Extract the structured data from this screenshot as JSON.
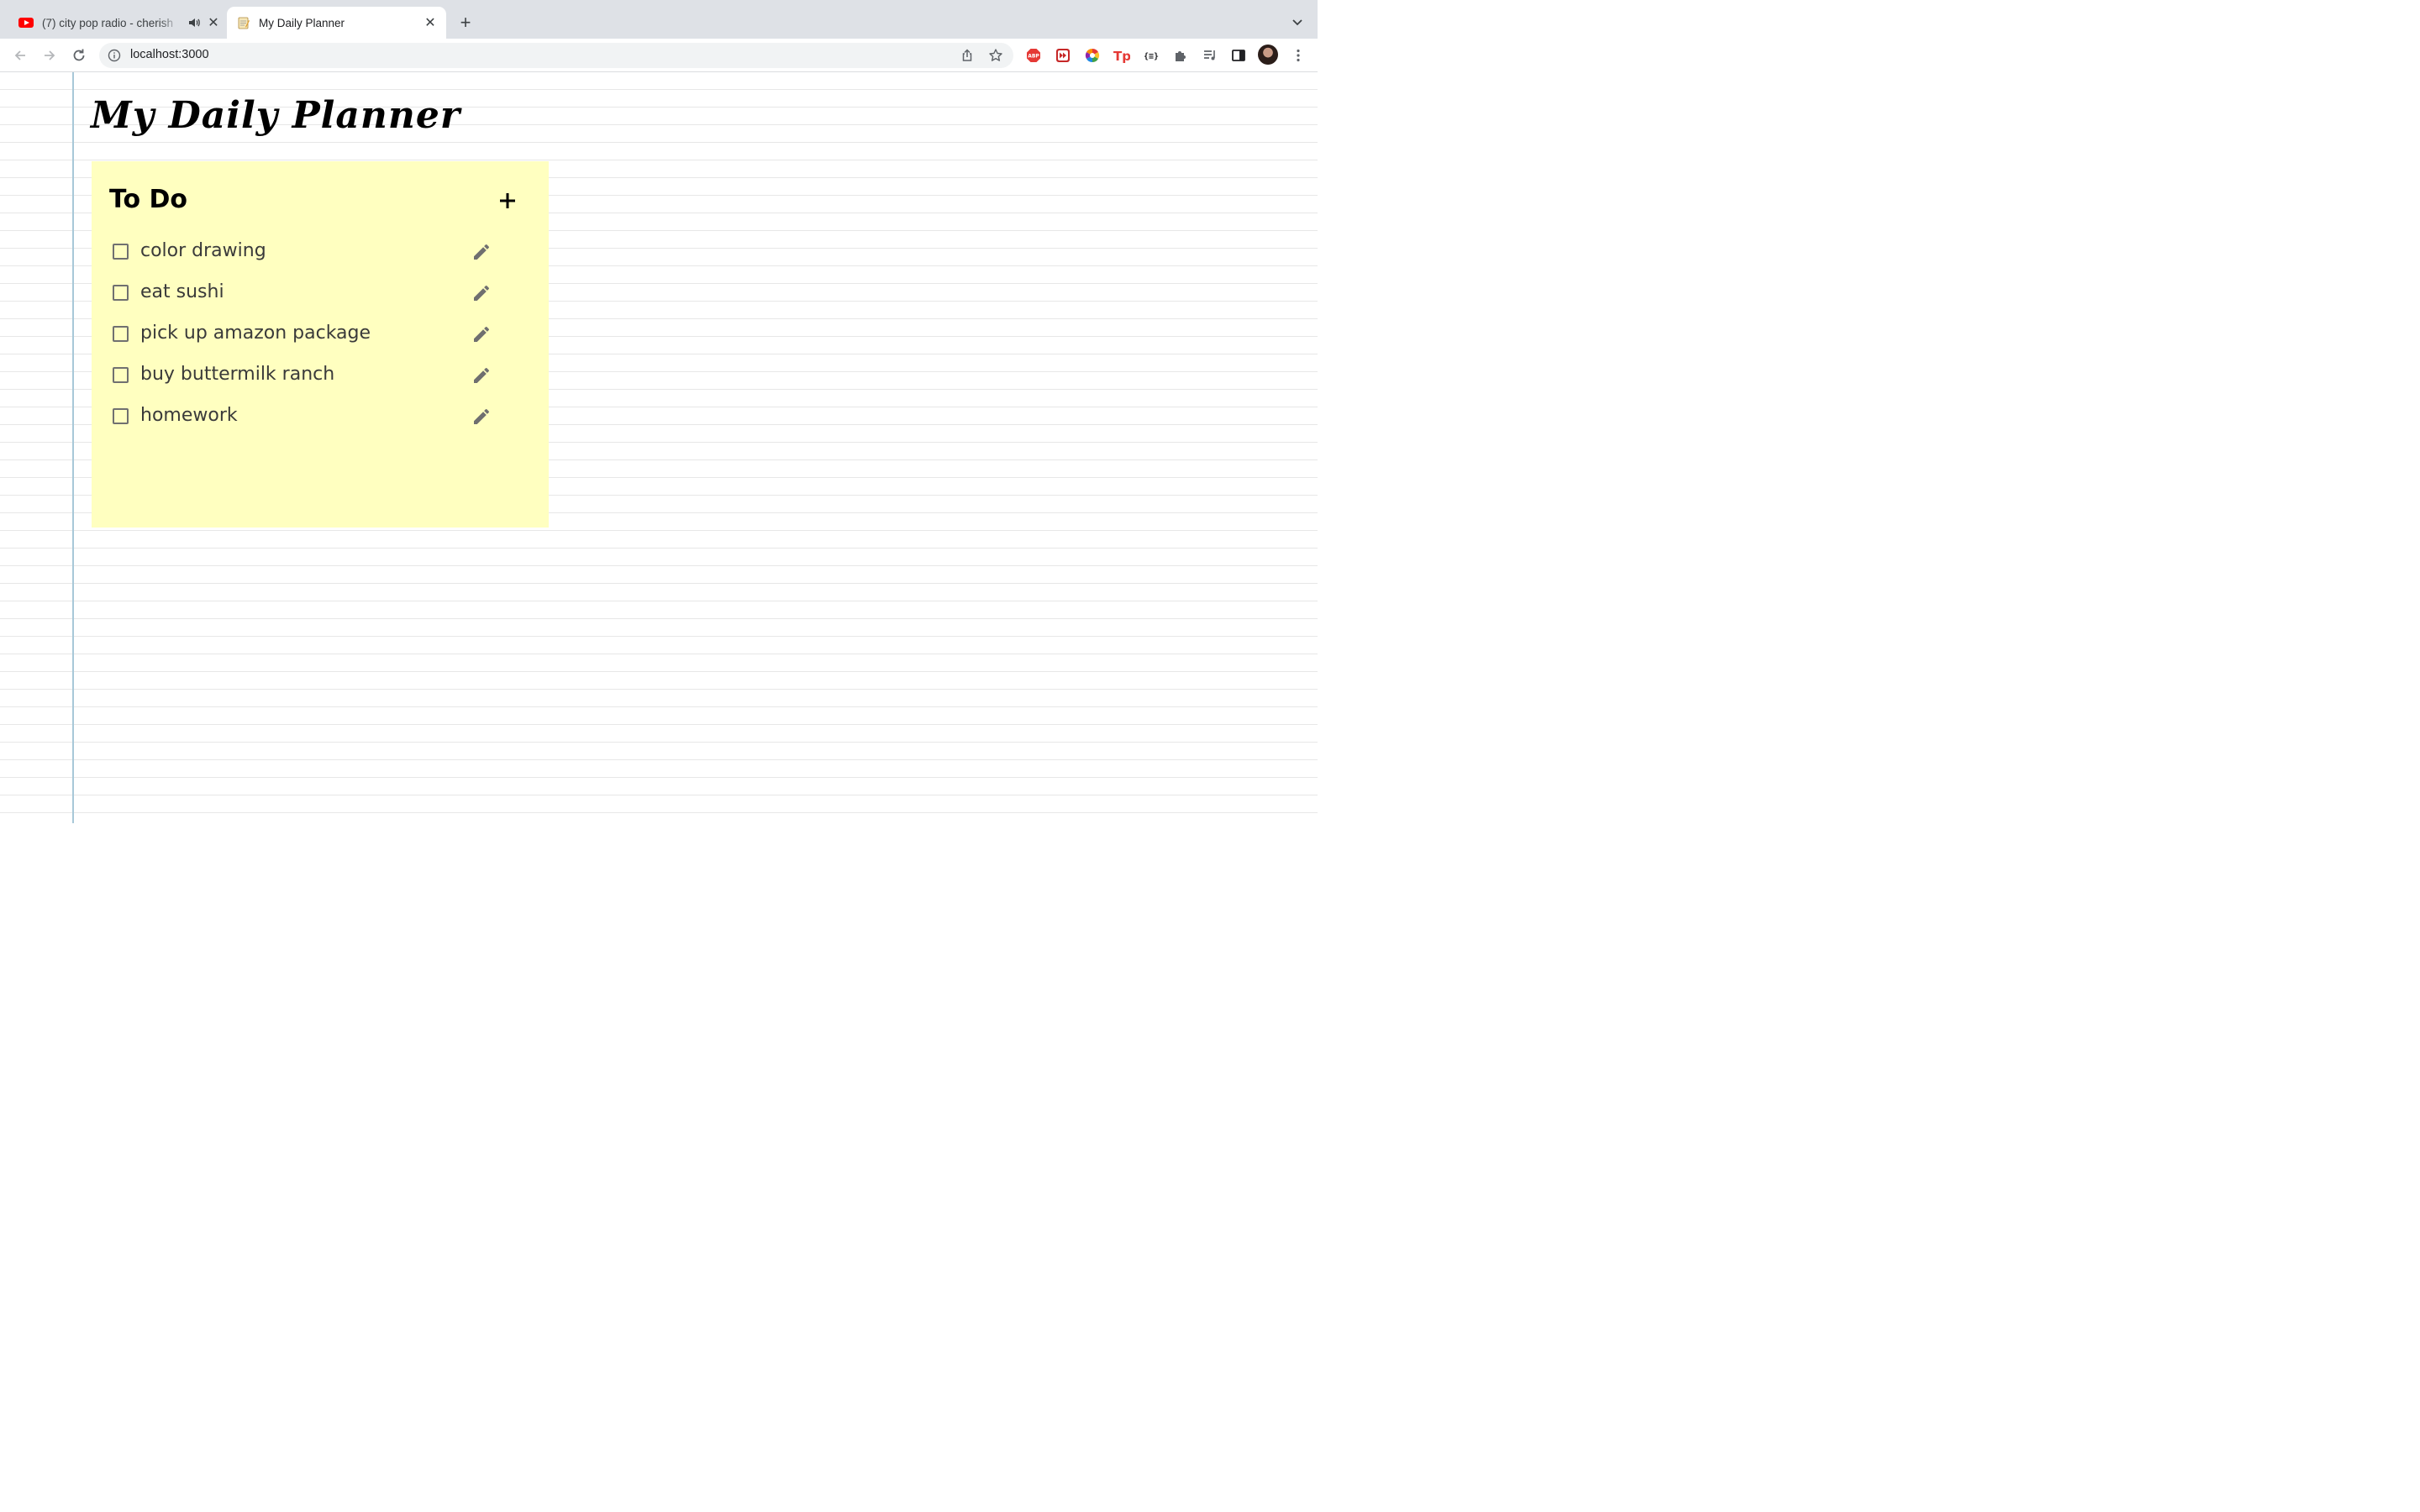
{
  "browser": {
    "tabs": [
      {
        "title": "(7) city pop radio - cherish",
        "icon": "youtube-icon",
        "audio": true,
        "active": false
      },
      {
        "title": "My Daily Planner",
        "icon": "notepad-icon",
        "active": true
      }
    ],
    "url": "localhost:3000",
    "extensions": [
      "adblock-icon",
      "media-forward-icon",
      "color-wheel-icon",
      "tp-icon",
      "json-viewer-icon",
      "puzzle-icon",
      "media-control-icon",
      "side-panel-icon"
    ]
  },
  "page": {
    "title": "My Daily Planner",
    "todo": {
      "heading": "To Do",
      "items": [
        {
          "text": "color drawing",
          "checked": false
        },
        {
          "text": "eat sushi",
          "checked": false
        },
        {
          "text": "pick up amazon package",
          "checked": false
        },
        {
          "text": "buy buttermilk ranch",
          "checked": false
        },
        {
          "text": "homework",
          "checked": false
        }
      ]
    }
  },
  "colors": {
    "sticky_note": "#ffffc0",
    "margin_line": "#a8c8d8",
    "ruled_line": "#e7e7e7"
  }
}
